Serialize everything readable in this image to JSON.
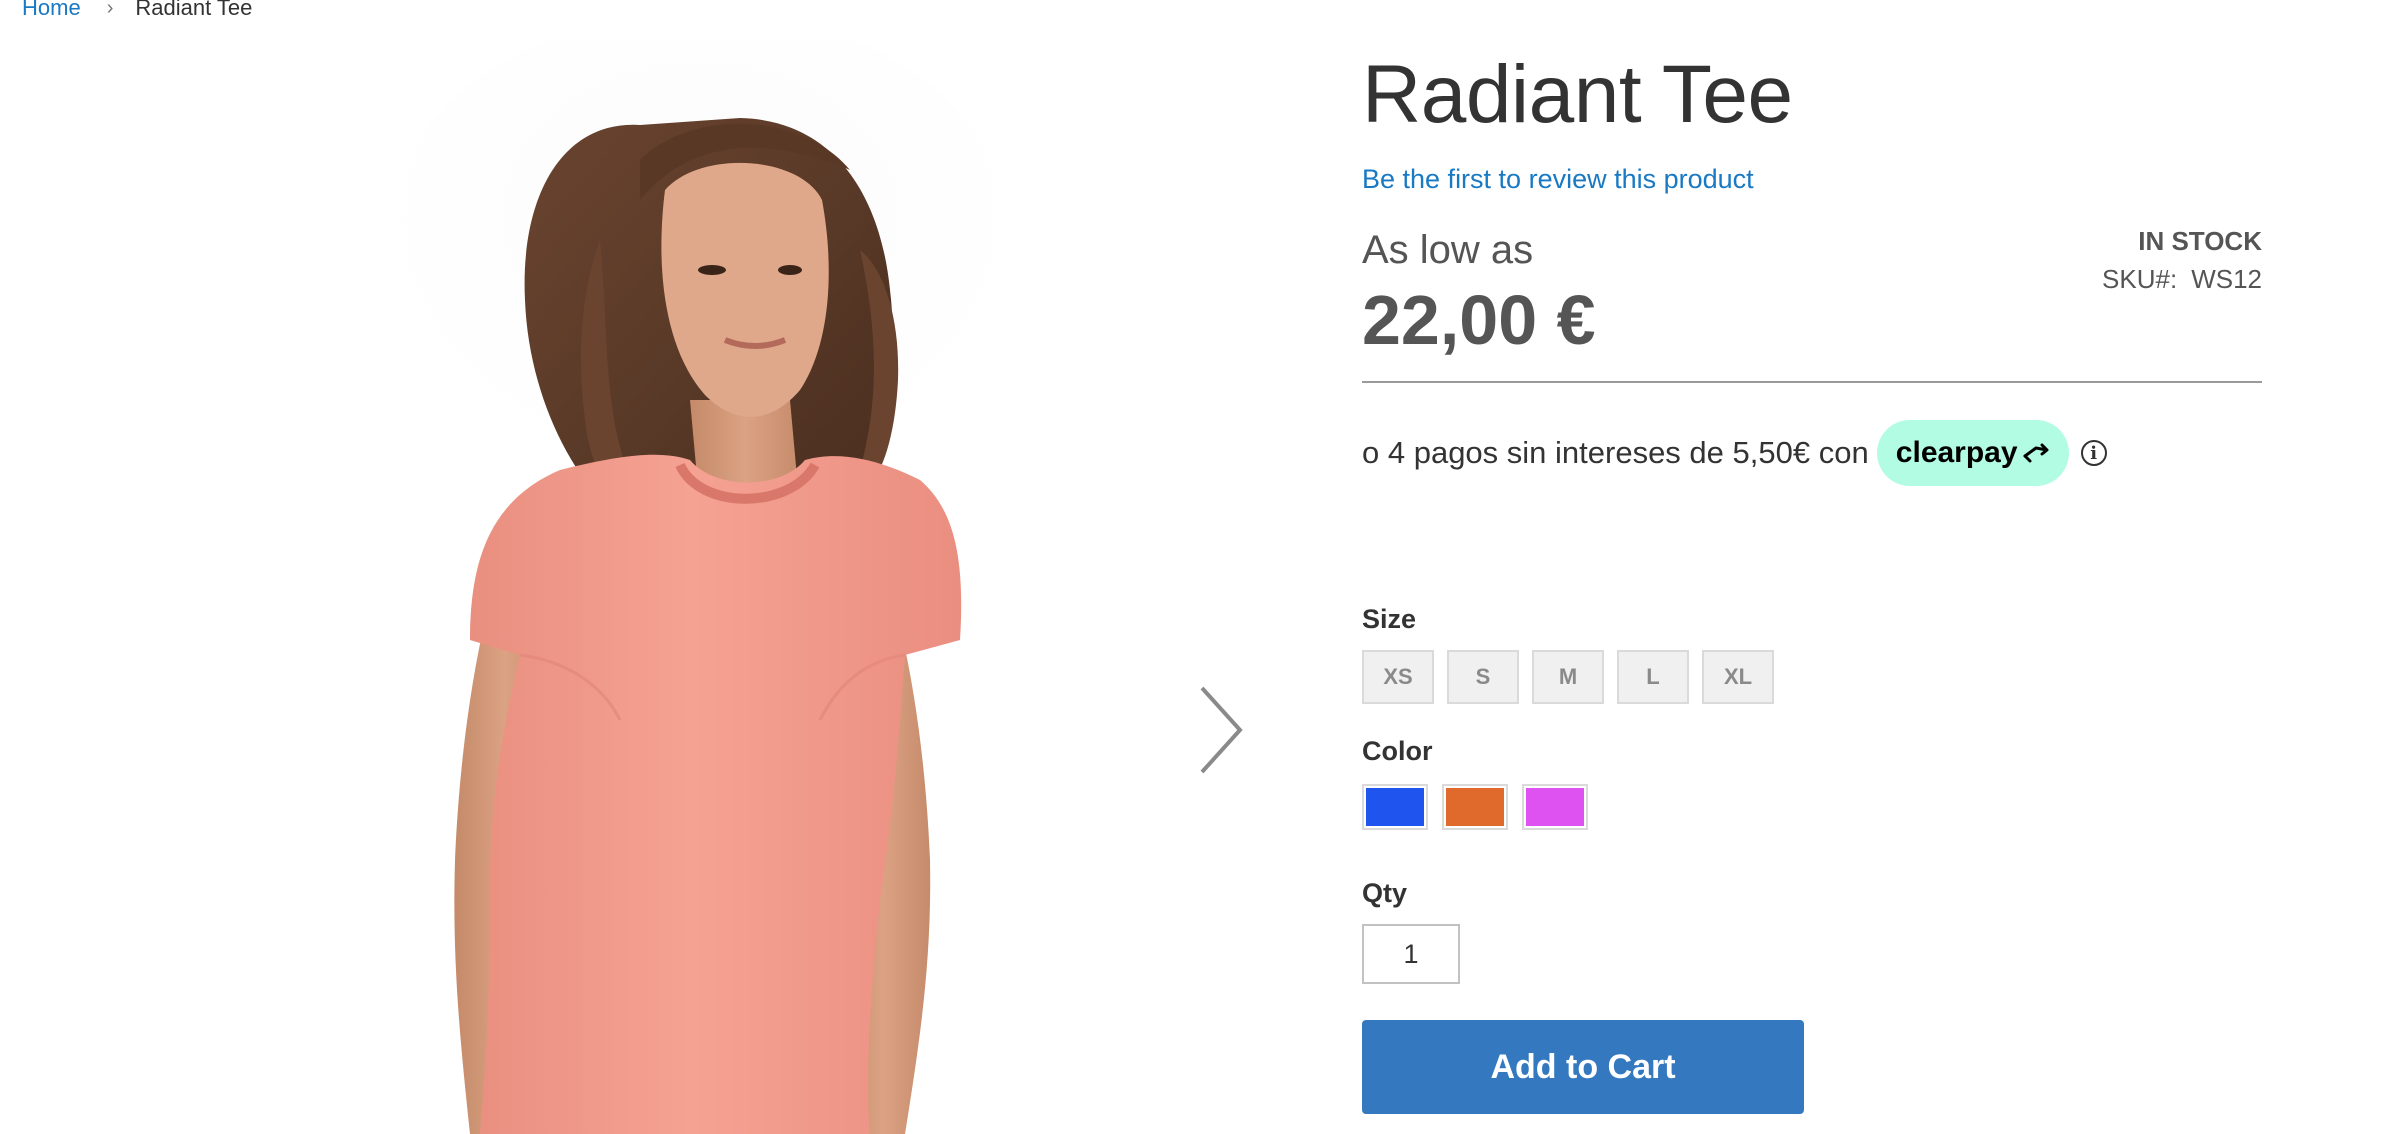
{
  "breadcrumb": {
    "home": "Home",
    "separator": "›",
    "current": "Radiant Tee"
  },
  "gallery": {
    "image_description_icon": "product-photo",
    "next_icon": "chevron-right-icon"
  },
  "product": {
    "title": "Radiant Tee",
    "review_link": "Be the first to review this product",
    "price_label": "As low as",
    "price": "22,00 €",
    "stock": "IN STOCK",
    "sku_label": "SKU#:",
    "sku_value": "WS12"
  },
  "clearpay": {
    "text": "o 4 pagos sin intereses de 5,50€ con",
    "brand": "clearpay",
    "info_icon": "ⓘ",
    "badge_color": "#b2fce4"
  },
  "options": {
    "size_label": "Size",
    "sizes": [
      "XS",
      "S",
      "M",
      "L",
      "XL"
    ],
    "color_label": "Color",
    "colors": [
      "#1f55ee",
      "#e06a2b",
      "#df52f2"
    ],
    "qty_label": "Qty",
    "qty_value": "1"
  },
  "cart": {
    "add_to_cart": "Add to Cart",
    "button_color": "#3479c0"
  }
}
